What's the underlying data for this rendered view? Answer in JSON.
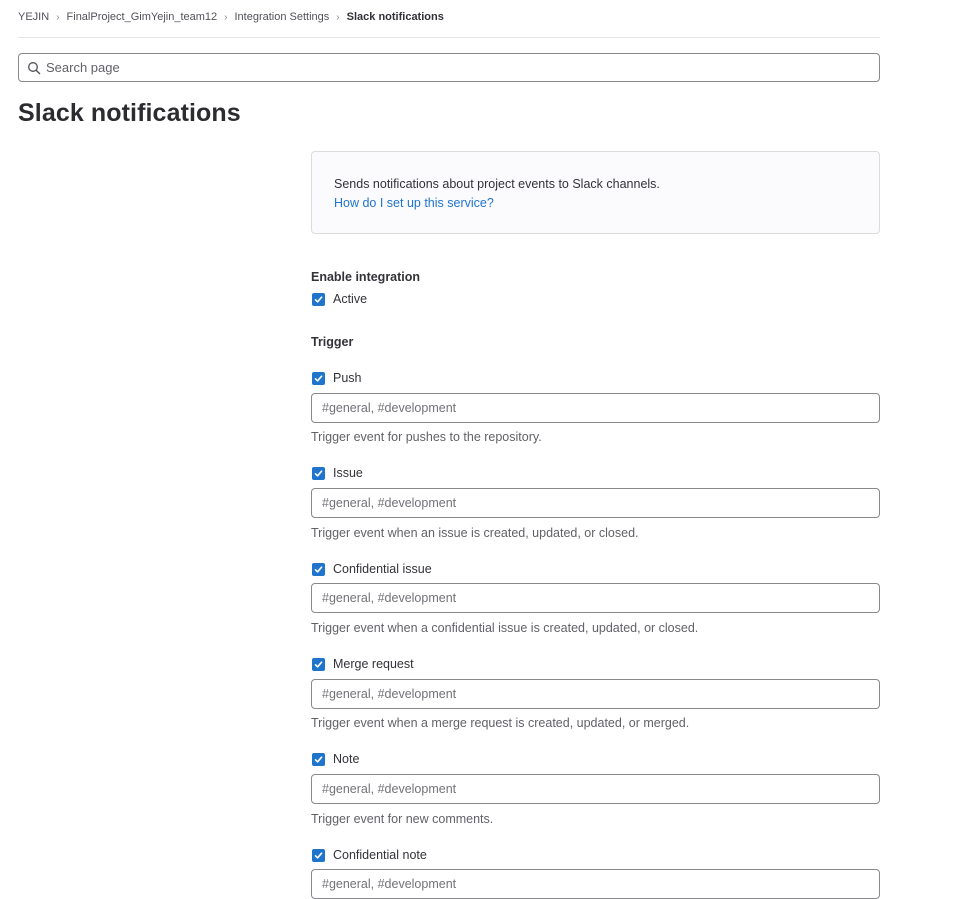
{
  "breadcrumb": {
    "items": [
      "YEJIN",
      "FinalProject_GimYejin_team12",
      "Integration Settings",
      "Slack notifications"
    ]
  },
  "search": {
    "placeholder": "Search page",
    "icon": "search-icon"
  },
  "page": {
    "title": "Slack notifications"
  },
  "info": {
    "description": "Sends notifications about project events to Slack channels.",
    "link": "How do I set up this service?"
  },
  "enable": {
    "label": "Enable integration",
    "active_label": "Active",
    "active_checked": true
  },
  "trigger": {
    "label": "Trigger",
    "items": [
      {
        "label": "Push",
        "checked": true,
        "placeholder": "#general, #development",
        "help": "Trigger event for pushes to the repository."
      },
      {
        "label": "Issue",
        "checked": true,
        "placeholder": "#general, #development",
        "help": "Trigger event when an issue is created, updated, or closed."
      },
      {
        "label": "Confidential issue",
        "checked": true,
        "placeholder": "#general, #development",
        "help": "Trigger event when a confidential issue is created, updated, or closed."
      },
      {
        "label": "Merge request",
        "checked": true,
        "placeholder": "#general, #development",
        "help": "Trigger event when a merge request is created, updated, or merged."
      },
      {
        "label": "Note",
        "checked": true,
        "placeholder": "#general, #development",
        "help": "Trigger event for new comments."
      },
      {
        "label": "Confidential note",
        "checked": true,
        "placeholder": "#general, #development",
        "help": ""
      }
    ]
  },
  "colors": {
    "accent": "#1f75cb",
    "text": "#333238",
    "muted": "#626168",
    "border": "#89888d"
  }
}
